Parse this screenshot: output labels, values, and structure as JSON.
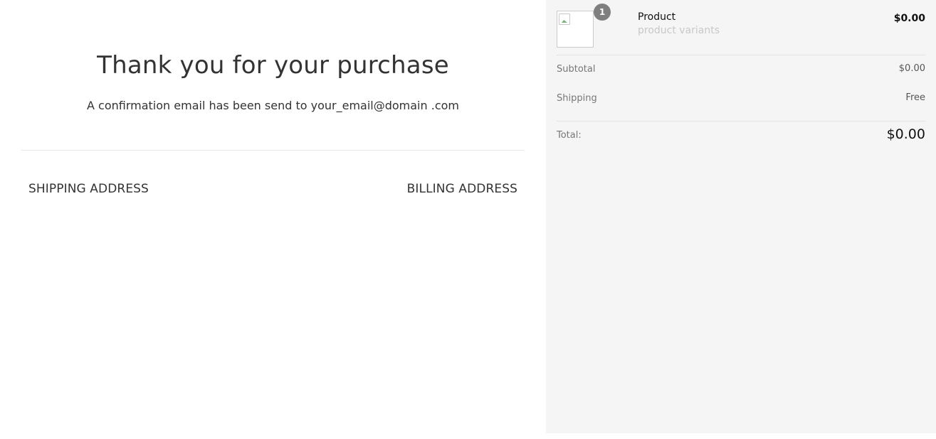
{
  "confirmation": {
    "title": "Thank you for your purchase",
    "message": "A confirmation email has been send to your_email@domain .com"
  },
  "addresses": {
    "shipping_heading": "SHIPPING ADDRESS",
    "billing_heading": "BILLING ADDRESS"
  },
  "order_summary": {
    "item": {
      "quantity": "1",
      "name": "Product",
      "variants": "product variants",
      "price": "$0.00",
      "image_icon": "broken-image-icon"
    },
    "subtotal_label": "Subtotal",
    "subtotal_value": "$0.00",
    "shipping_label": "Shipping",
    "shipping_value": "Free",
    "total_label": "Total:",
    "total_value": "$0.00"
  },
  "colors": {
    "sidebar_background": "#f5f5f5",
    "badge_background": "#7f7f7f",
    "text_primary": "#333333",
    "text_muted": "#c8c8c8"
  }
}
